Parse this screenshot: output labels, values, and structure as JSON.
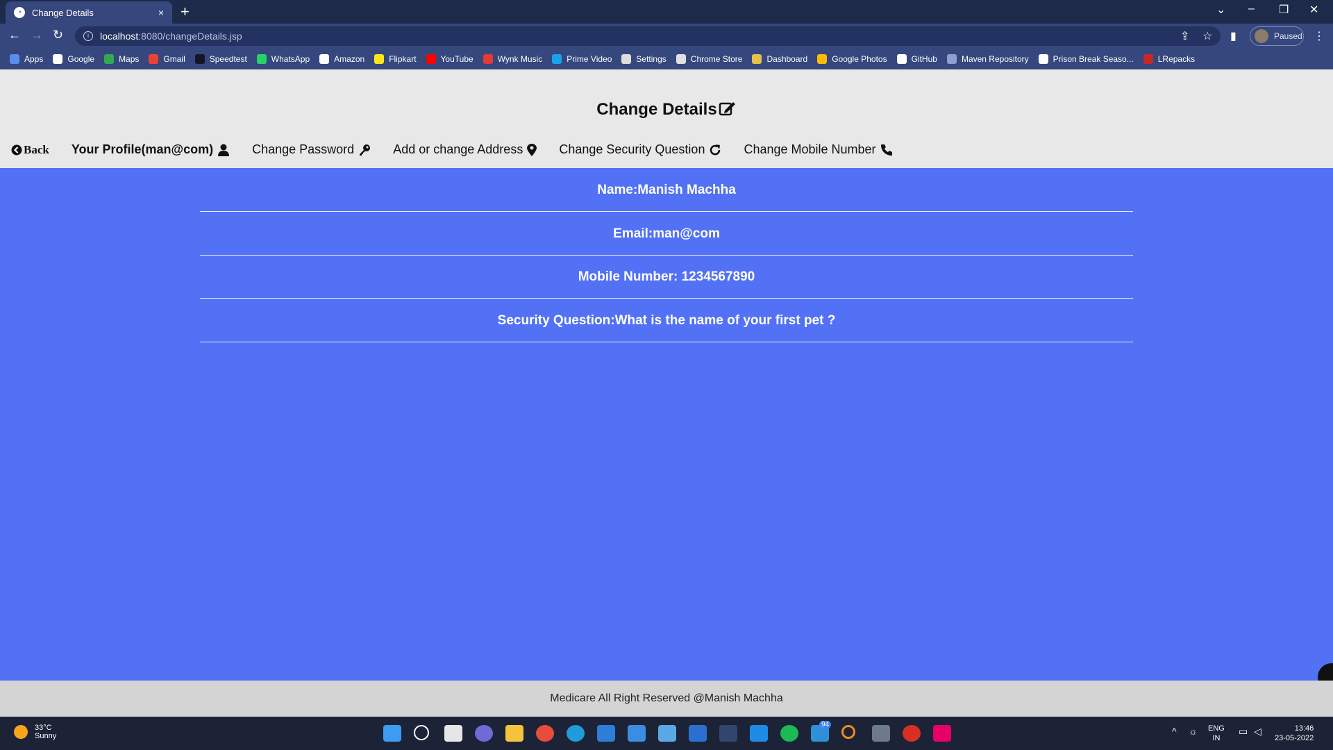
{
  "browser": {
    "tab_title": "Change Details",
    "tab_close": "×",
    "new_tab": "+",
    "url_host": "localhost",
    "url_path": ":8080/changeDetails.jsp",
    "profile_status": "Paused",
    "bookmarks": [
      {
        "label": "Apps",
        "icon": "apps-grid-icon",
        "color": "#5b8dee"
      },
      {
        "label": "Google",
        "icon": "google-icon",
        "color": "#ffffff"
      },
      {
        "label": "Maps",
        "icon": "maps-icon",
        "color": "#34a853"
      },
      {
        "label": "Gmail",
        "icon": "gmail-icon",
        "color": "#ea4335"
      },
      {
        "label": "Speedtest",
        "icon": "speedtest-icon",
        "color": "#141526"
      },
      {
        "label": "WhatsApp",
        "icon": "whatsapp-icon",
        "color": "#25d366"
      },
      {
        "label": "Amazon",
        "icon": "amazon-icon",
        "color": "#ffffff"
      },
      {
        "label": "Flipkart",
        "icon": "flipkart-icon",
        "color": "#f8e71c"
      },
      {
        "label": "YouTube",
        "icon": "youtube-icon",
        "color": "#ff0000"
      },
      {
        "label": "Wynk Music",
        "icon": "wynk-icon",
        "color": "#e53935"
      },
      {
        "label": "Prime Video",
        "icon": "prime-video-icon",
        "color": "#1aa3e8"
      },
      {
        "label": "Settings",
        "icon": "settings-gear-icon",
        "color": "#dddddd"
      },
      {
        "label": "Chrome Store",
        "icon": "chrome-store-icon",
        "color": "#e0e0e0"
      },
      {
        "label": "Dashboard",
        "icon": "dashboard-icon",
        "color": "#e6c24a"
      },
      {
        "label": "Google Photos",
        "icon": "google-photos-icon",
        "color": "#fbbc05"
      },
      {
        "label": "GitHub",
        "icon": "github-icon",
        "color": "#ffffff"
      },
      {
        "label": "Maven Repository",
        "icon": "maven-icon",
        "color": "#8fa0d0"
      },
      {
        "label": "Prison Break Seaso...",
        "icon": "wordpress-icon",
        "color": "#ffffff"
      },
      {
        "label": "LRepacks",
        "icon": "lrepacks-icon",
        "color": "#c62828"
      }
    ]
  },
  "page": {
    "title": "Change Details",
    "nav": {
      "back": "Back",
      "profile": "Your Profile(man@com)",
      "change_password": "Change Password",
      "address": "Add or change Address",
      "security_question": "Change Security Question",
      "mobile": "Change Mobile Number"
    },
    "details": {
      "name": "Name:Manish Machha",
      "email": "Email:man@com",
      "mobile": "Mobile Number: 1234567890",
      "security_question": "Security Question:What is the name of your first pet ?"
    },
    "footer": "Medicare All Right Reserved @Manish Machha"
  },
  "taskbar": {
    "temperature": "33°C",
    "weather": "Sunny",
    "language": "ENG",
    "region": "IN",
    "time": "13:46",
    "date": "23-05-2022",
    "badge": "94"
  },
  "colors": {
    "main_bg": "#5271f5",
    "header_bg": "#e8e8e8",
    "footer_bg": "#d4d4d4",
    "chrome_dark": "#1e2a4a",
    "chrome_toolbar": "#35477d"
  }
}
